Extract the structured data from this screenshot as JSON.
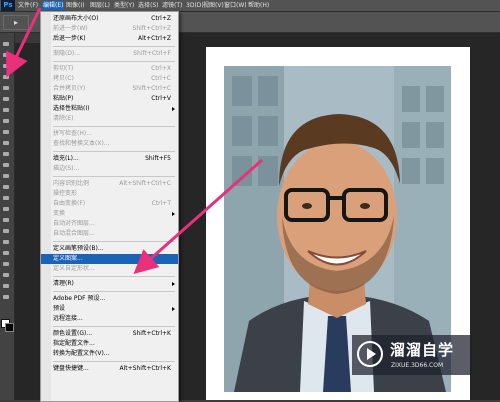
{
  "app": {
    "logo": "Ps"
  },
  "menubar": {
    "items": [
      {
        "label": "文件(F)"
      },
      {
        "label": "编辑(E)"
      },
      {
        "label": "图像(I)"
      },
      {
        "label": "图层(L)"
      },
      {
        "label": "类型(Y)"
      },
      {
        "label": "选择(S)"
      },
      {
        "label": "滤镜(T)"
      },
      {
        "label": "3D(D)"
      },
      {
        "label": "视图(V)"
      },
      {
        "label": "窗口(W)"
      },
      {
        "label": "帮助(H)"
      }
    ],
    "active": "编辑(E)"
  },
  "options_bar": {
    "tool_icon": "move-tool-icon",
    "tool_glyph": "▸"
  },
  "edit_menu": {
    "items": [
      {
        "label": "还原画布大小(O)",
        "shortcut": "Ctrl+Z",
        "state": "enabled"
      },
      {
        "label": "前进一步(W)",
        "shortcut": "Shift+Ctrl+Z",
        "state": "disabled"
      },
      {
        "label": "后退一步(K)",
        "shortcut": "Alt+Ctrl+Z",
        "state": "enabled"
      },
      {
        "separator": true
      },
      {
        "label": "渐隐(D)...",
        "shortcut": "Shift+Ctrl+F",
        "state": "disabled"
      },
      {
        "separator": true
      },
      {
        "label": "剪切(T)",
        "shortcut": "Ctrl+X",
        "state": "disabled"
      },
      {
        "label": "拷贝(C)",
        "shortcut": "Ctrl+C",
        "state": "disabled"
      },
      {
        "label": "合并拷贝(Y)",
        "shortcut": "Shift+Ctrl+C",
        "state": "disabled"
      },
      {
        "label": "粘贴(P)",
        "shortcut": "Ctrl+V",
        "state": "enabled"
      },
      {
        "label": "选择性粘贴(I)",
        "shortcut": "",
        "state": "enabled",
        "submenu": true
      },
      {
        "label": "清除(E)",
        "shortcut": "",
        "state": "disabled"
      },
      {
        "separator": true
      },
      {
        "label": "拼写检查(H)...",
        "shortcut": "",
        "state": "disabled"
      },
      {
        "label": "查找和替换文本(X)...",
        "shortcut": "",
        "state": "disabled"
      },
      {
        "separator": true
      },
      {
        "label": "填充(L)...",
        "shortcut": "Shift+F5",
        "state": "enabled"
      },
      {
        "label": "描边(S)...",
        "shortcut": "",
        "state": "disabled"
      },
      {
        "separator": true
      },
      {
        "label": "内容识别比例",
        "shortcut": "Alt+Shift+Ctrl+C",
        "state": "disabled"
      },
      {
        "label": "操控变形",
        "shortcut": "",
        "state": "disabled"
      },
      {
        "label": "自由变换(F)",
        "shortcut": "Ctrl+T",
        "state": "disabled"
      },
      {
        "label": "变换",
        "shortcut": "",
        "state": "disabled",
        "submenu": true
      },
      {
        "label": "自动对齐图层...",
        "shortcut": "",
        "state": "disabled"
      },
      {
        "label": "自动混合图层...",
        "shortcut": "",
        "state": "disabled"
      },
      {
        "separator": true
      },
      {
        "label": "定义画笔预设(B)...",
        "shortcut": "",
        "state": "enabled"
      },
      {
        "label": "定义图案...",
        "shortcut": "",
        "state": "highlighted"
      },
      {
        "label": "定义自定形状...",
        "shortcut": "",
        "state": "disabled"
      },
      {
        "separator": true
      },
      {
        "label": "清理(R)",
        "shortcut": "",
        "state": "enabled",
        "submenu": true
      },
      {
        "separator": true
      },
      {
        "label": "Adobe PDF 预设...",
        "shortcut": "",
        "state": "enabled"
      },
      {
        "label": "预设",
        "shortcut": "",
        "state": "enabled",
        "submenu": true
      },
      {
        "label": "远程连接...",
        "shortcut": "",
        "state": "enabled"
      },
      {
        "separator": true
      },
      {
        "label": "颜色设置(G)...",
        "shortcut": "Shift+Ctrl+K",
        "state": "enabled"
      },
      {
        "label": "指定配置文件...",
        "shortcut": "",
        "state": "enabled"
      },
      {
        "label": "转换为配置文件(V)...",
        "shortcut": "",
        "state": "enabled"
      },
      {
        "separator": true
      },
      {
        "label": "键盘快捷键...",
        "shortcut": "Alt+Shift+Ctrl+K",
        "state": "enabled"
      }
    ]
  },
  "colors": {
    "arrow": "#e8317a",
    "menu_highlight": "#1a63b7",
    "canvas_bg": "#262626"
  },
  "watermark": {
    "title": "溜溜自学",
    "subtitle": "ZIXUE.3D66.COM"
  }
}
